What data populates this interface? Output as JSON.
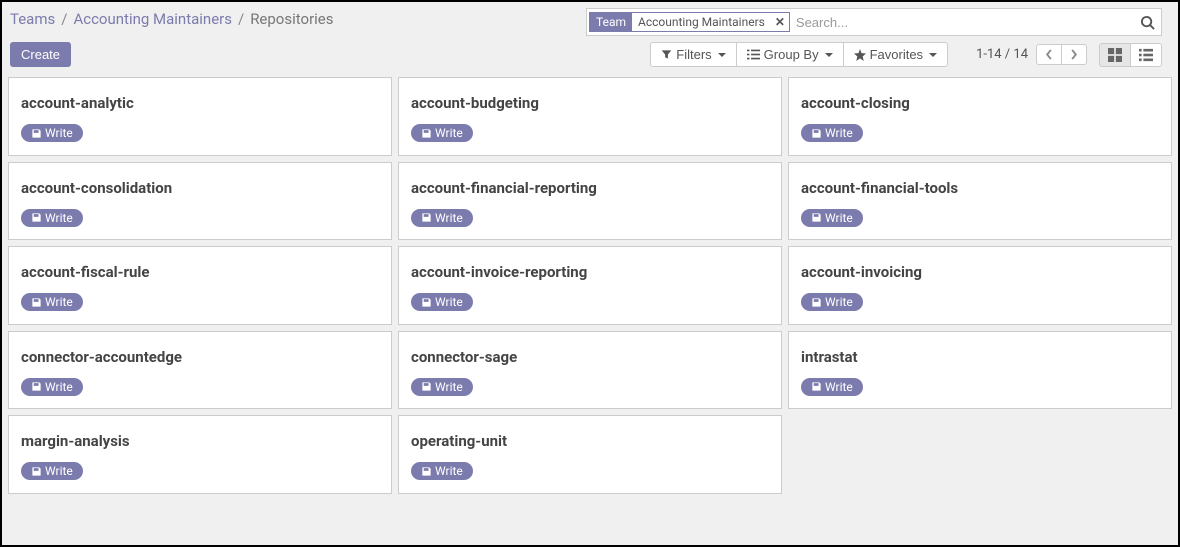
{
  "breadcrumb": {
    "level1": "Teams",
    "level2": "Accounting Maintainers",
    "current": "Repositories"
  },
  "search": {
    "facet_label": "Team",
    "facet_value": "Accounting Maintainers",
    "placeholder": "Search..."
  },
  "toolbar": {
    "create": "Create",
    "filters": "Filters",
    "group_by": "Group By",
    "favorites": "Favorites",
    "pager": "1-14 / 14"
  },
  "cards": [
    {
      "title": "account-analytic",
      "action": "Write"
    },
    {
      "title": "account-budgeting",
      "action": "Write"
    },
    {
      "title": "account-closing",
      "action": "Write"
    },
    {
      "title": "account-consolidation",
      "action": "Write"
    },
    {
      "title": "account-financial-reporting",
      "action": "Write"
    },
    {
      "title": "account-financial-tools",
      "action": "Write"
    },
    {
      "title": "account-fiscal-rule",
      "action": "Write"
    },
    {
      "title": "account-invoice-reporting",
      "action": "Write"
    },
    {
      "title": "account-invoicing",
      "action": "Write"
    },
    {
      "title": "connector-accountedge",
      "action": "Write"
    },
    {
      "title": "connector-sage",
      "action": "Write"
    },
    {
      "title": "intrastat",
      "action": "Write"
    },
    {
      "title": "margin-analysis",
      "action": "Write"
    },
    {
      "title": "operating-unit",
      "action": "Write"
    }
  ]
}
